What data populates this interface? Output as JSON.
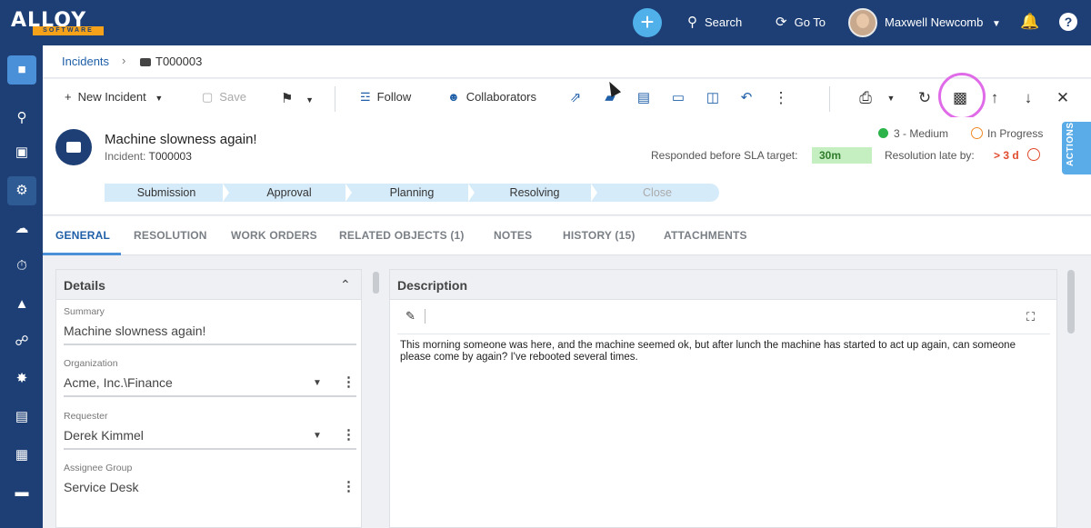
{
  "app": {
    "logo_main": "ALLOY",
    "logo_sub": "SOFTWARE"
  },
  "topbar": {
    "add_label": "+",
    "search_label": "Search",
    "goto_label": "Go To",
    "user_name": "Maxwell Newcomb",
    "help_label": "?"
  },
  "breadcrumb": {
    "parent": "Incidents",
    "current": "T000003"
  },
  "toolbar": {
    "new_incident": "New Incident",
    "save": "Save",
    "follow": "Follow",
    "collaborators": "Collaborators"
  },
  "ticket": {
    "title": "Machine slowness again!",
    "id_label": "Incident:",
    "id": "T000003",
    "priority": "3 - Medium",
    "status": "In Progress",
    "sla_label": "Responded before SLA target:",
    "sla_value": "30m",
    "late_label": "Resolution late by:",
    "late_value": "> 3 d",
    "actions_label": "ACTIONS"
  },
  "steps": [
    "Submission",
    "Approval",
    "Planning",
    "Resolving",
    "Close"
  ],
  "tabs": [
    "GENERAL",
    "RESOLUTION",
    "WORK ORDERS",
    "RELATED OBJECTS (1)",
    "NOTES",
    "HISTORY (15)",
    "ATTACHMENTS"
  ],
  "details": {
    "title": "Details",
    "fields": [
      {
        "label": "Summary",
        "value": "Machine slowness again!"
      },
      {
        "label": "Organization",
        "value": "Acme, Inc.\\Finance"
      },
      {
        "label": "Requester",
        "value": "Derek Kimmel"
      },
      {
        "label": "Assignee Group",
        "value": "Service Desk"
      }
    ]
  },
  "description": {
    "title": "Description",
    "text": "This morning someone was here, and the machine seemed ok, but after lunch the machine has started to act up again, can someone please come by again? I've rebooted several times."
  },
  "colors": {
    "navy": "#1d3f75",
    "accent": "#4a90d9",
    "sla_green": "#c6efc1",
    "late_red": "#e04b2c",
    "highlight": "#e06be8"
  }
}
